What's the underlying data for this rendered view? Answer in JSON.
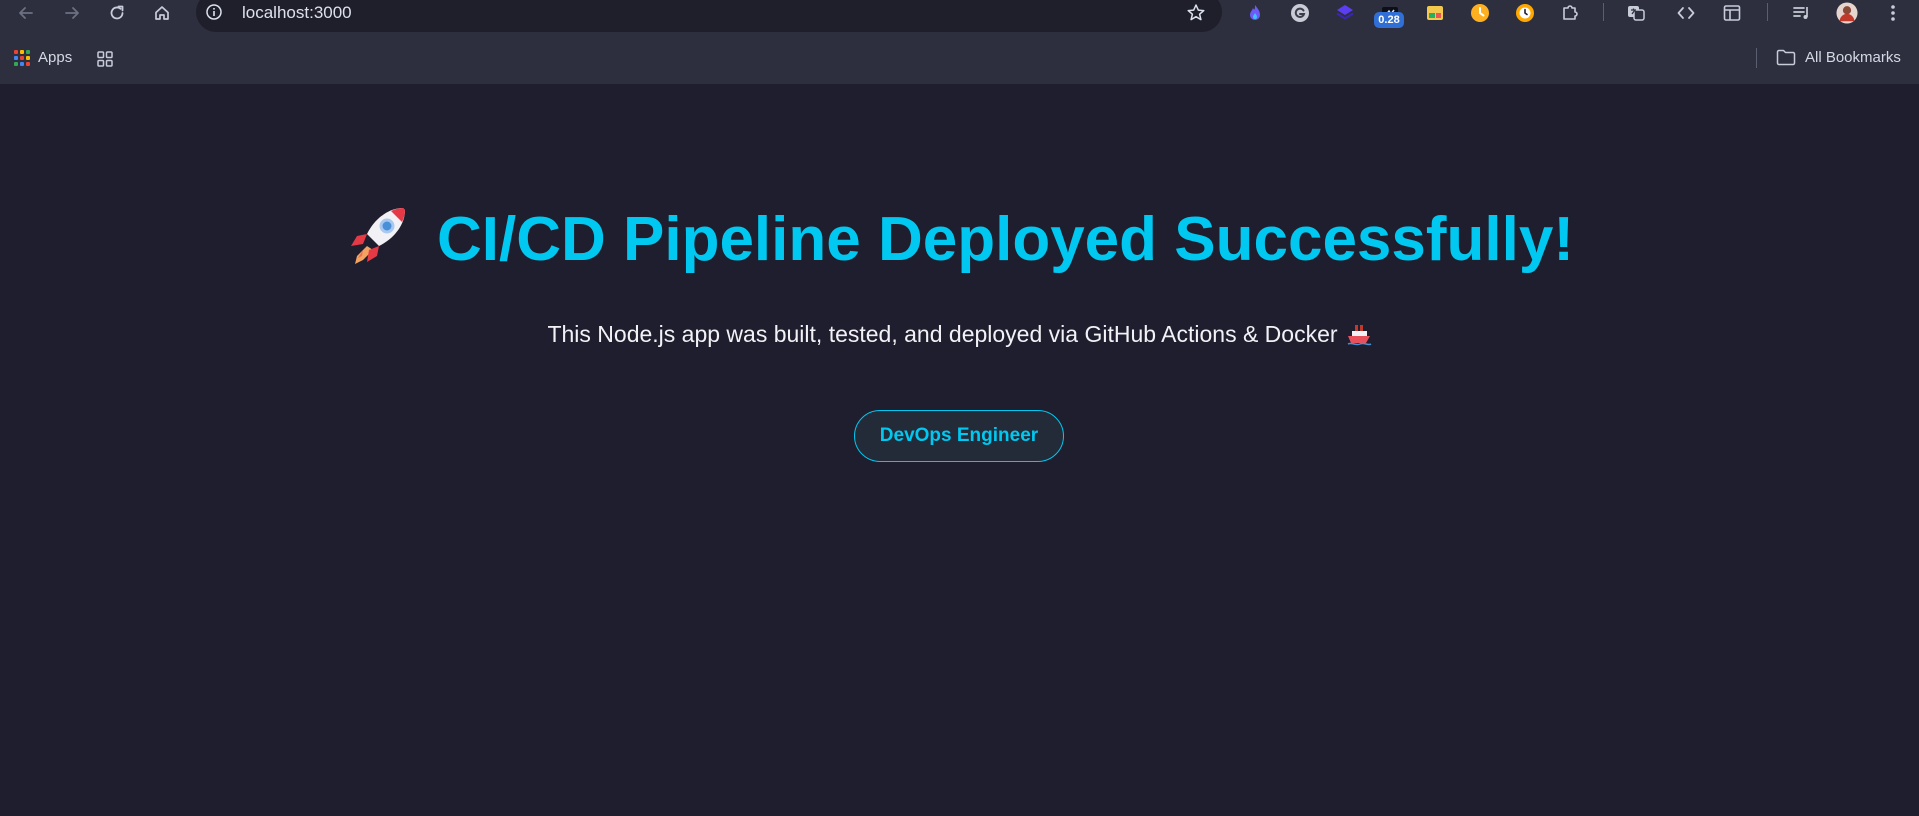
{
  "browser": {
    "url": "localhost:3000",
    "extensions": [
      "flame-icon",
      "grammar-icon",
      "layers-icon",
      "score-icon",
      "sheets-icon",
      "clock-icon",
      "timer-icon",
      "puzzle-icon",
      "translate-icon",
      "code-icon",
      "layout-icon",
      "playlist-icon",
      "avatar",
      "menu-icon"
    ],
    "badge_value": "0.28"
  },
  "bookmarks": {
    "apps_label": "Apps",
    "all_bookmarks_label": "All Bookmarks"
  },
  "page": {
    "title": "CI/CD Pipeline Deployed Successfully!",
    "subtitle": "This Node.js app was built, tested, and deployed via GitHub Actions & Docker",
    "role_label": "DevOps Engineer"
  },
  "colors": {
    "accent": "#00c8f0",
    "background": "#1e1e2e",
    "chrome": "#2d2f3f",
    "text": "#f2f2f6"
  }
}
